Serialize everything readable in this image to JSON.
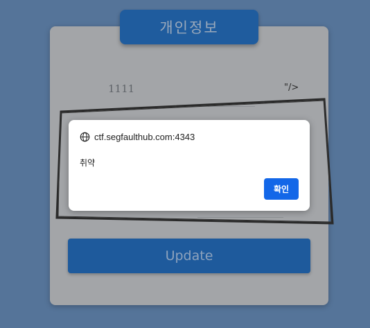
{
  "page": {
    "title_tab": "개인정보",
    "field_value": "1111",
    "field_tail": "\"/>",
    "update_label": "Update"
  },
  "dialog": {
    "origin": "ctf.segfaulthub.com:4343",
    "message": "취약",
    "ok_label": "확인"
  },
  "colors": {
    "background": "#557499",
    "card": "#a3a5a8",
    "primary": "#1f5c9e",
    "dialog_button": "#1367e8"
  },
  "icons": {
    "origin_icon": "globe-icon"
  }
}
